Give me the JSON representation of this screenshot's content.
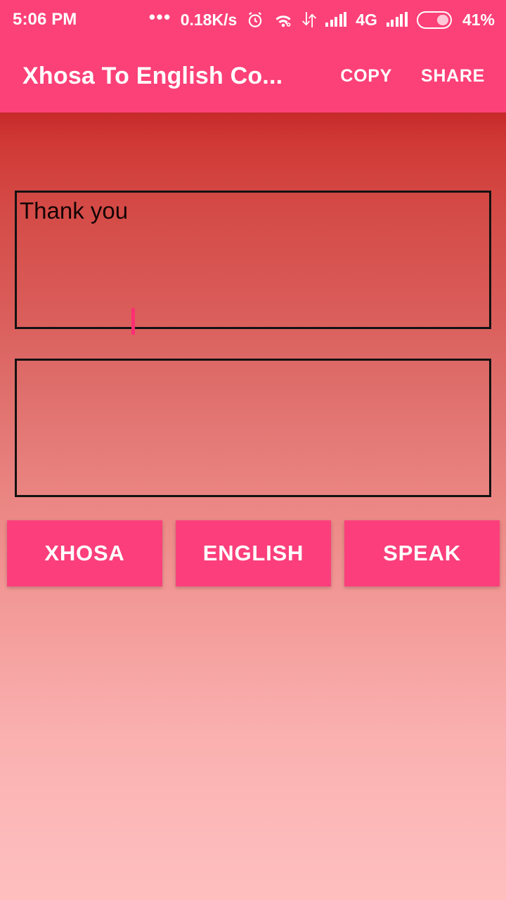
{
  "status_bar": {
    "clock": "5:06 PM",
    "overflow_dots": "•••",
    "network_speed": "0.18K/s",
    "alarm_icon": "alarm-clock-icon",
    "wifi_icon": "wifi-icon",
    "data_transfer_icon": "data-transfer-icon",
    "signal_1_icon": "signal-bars-icon",
    "network_type": "4G",
    "signal_2_icon": "signal-bars-icon",
    "battery_icon": "battery-icon",
    "battery_level": "41%",
    "battery_fill_percent": 41
  },
  "app_bar": {
    "title": "Xhosa To English Co...",
    "copy_label": "COPY",
    "share_label": "SHARE"
  },
  "main": {
    "input_text": "Thank you",
    "input_placeholder": "",
    "output_text": "",
    "output_placeholder": ""
  },
  "buttons": {
    "xhosa_label": "XHOSA",
    "english_label": "ENGLISH",
    "speak_label": "SPEAK"
  },
  "colors": {
    "accent_pink": "#FC4178",
    "button_pink": "#FC3F7C",
    "background_top": "#C62A2A",
    "background_bottom": "#FFBFBF",
    "caret": "#FF2E74",
    "box_border": "#121212",
    "text_on_accent": "#FFFFFF"
  }
}
